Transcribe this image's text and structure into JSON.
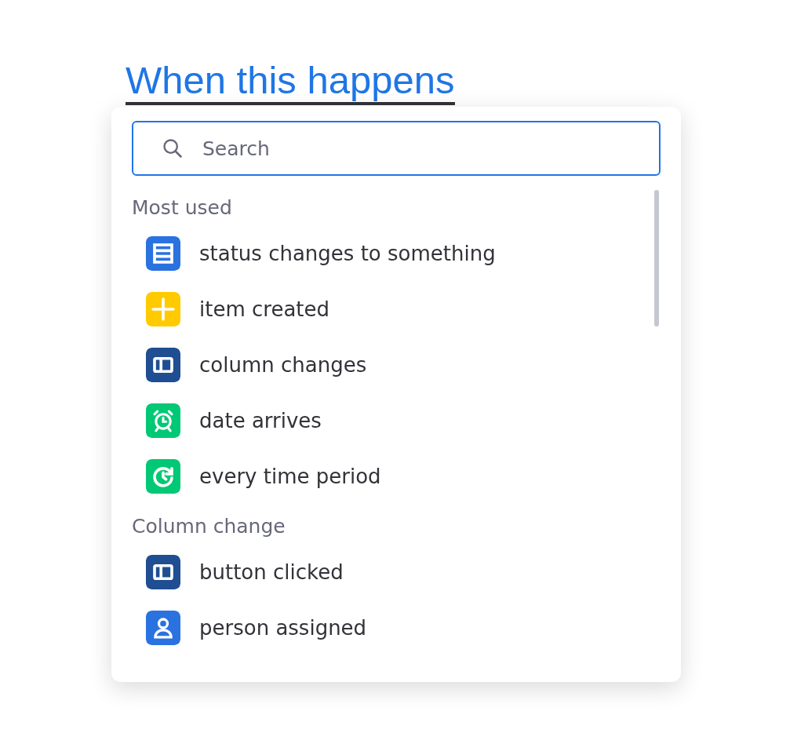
{
  "heading": "When this happens",
  "search": {
    "placeholder": "Search"
  },
  "sections": [
    {
      "title": "Most used",
      "items": [
        {
          "label": "status changes to something",
          "kind": "table",
          "color": "#2a72e0"
        },
        {
          "label": "item created",
          "kind": "plus",
          "color": "#ffcb00"
        },
        {
          "label": "column changes",
          "kind": "column",
          "color": "#1f4e92"
        },
        {
          "label": "date arrives",
          "kind": "alarm",
          "color": "#00c875"
        },
        {
          "label": "every time period",
          "kind": "recurring",
          "color": "#00c875"
        }
      ]
    },
    {
      "title": "Column change",
      "items": [
        {
          "label": "button clicked",
          "kind": "column",
          "color": "#1f4e92"
        },
        {
          "label": "person assigned",
          "kind": "person",
          "color": "#2a72e0"
        }
      ]
    }
  ]
}
